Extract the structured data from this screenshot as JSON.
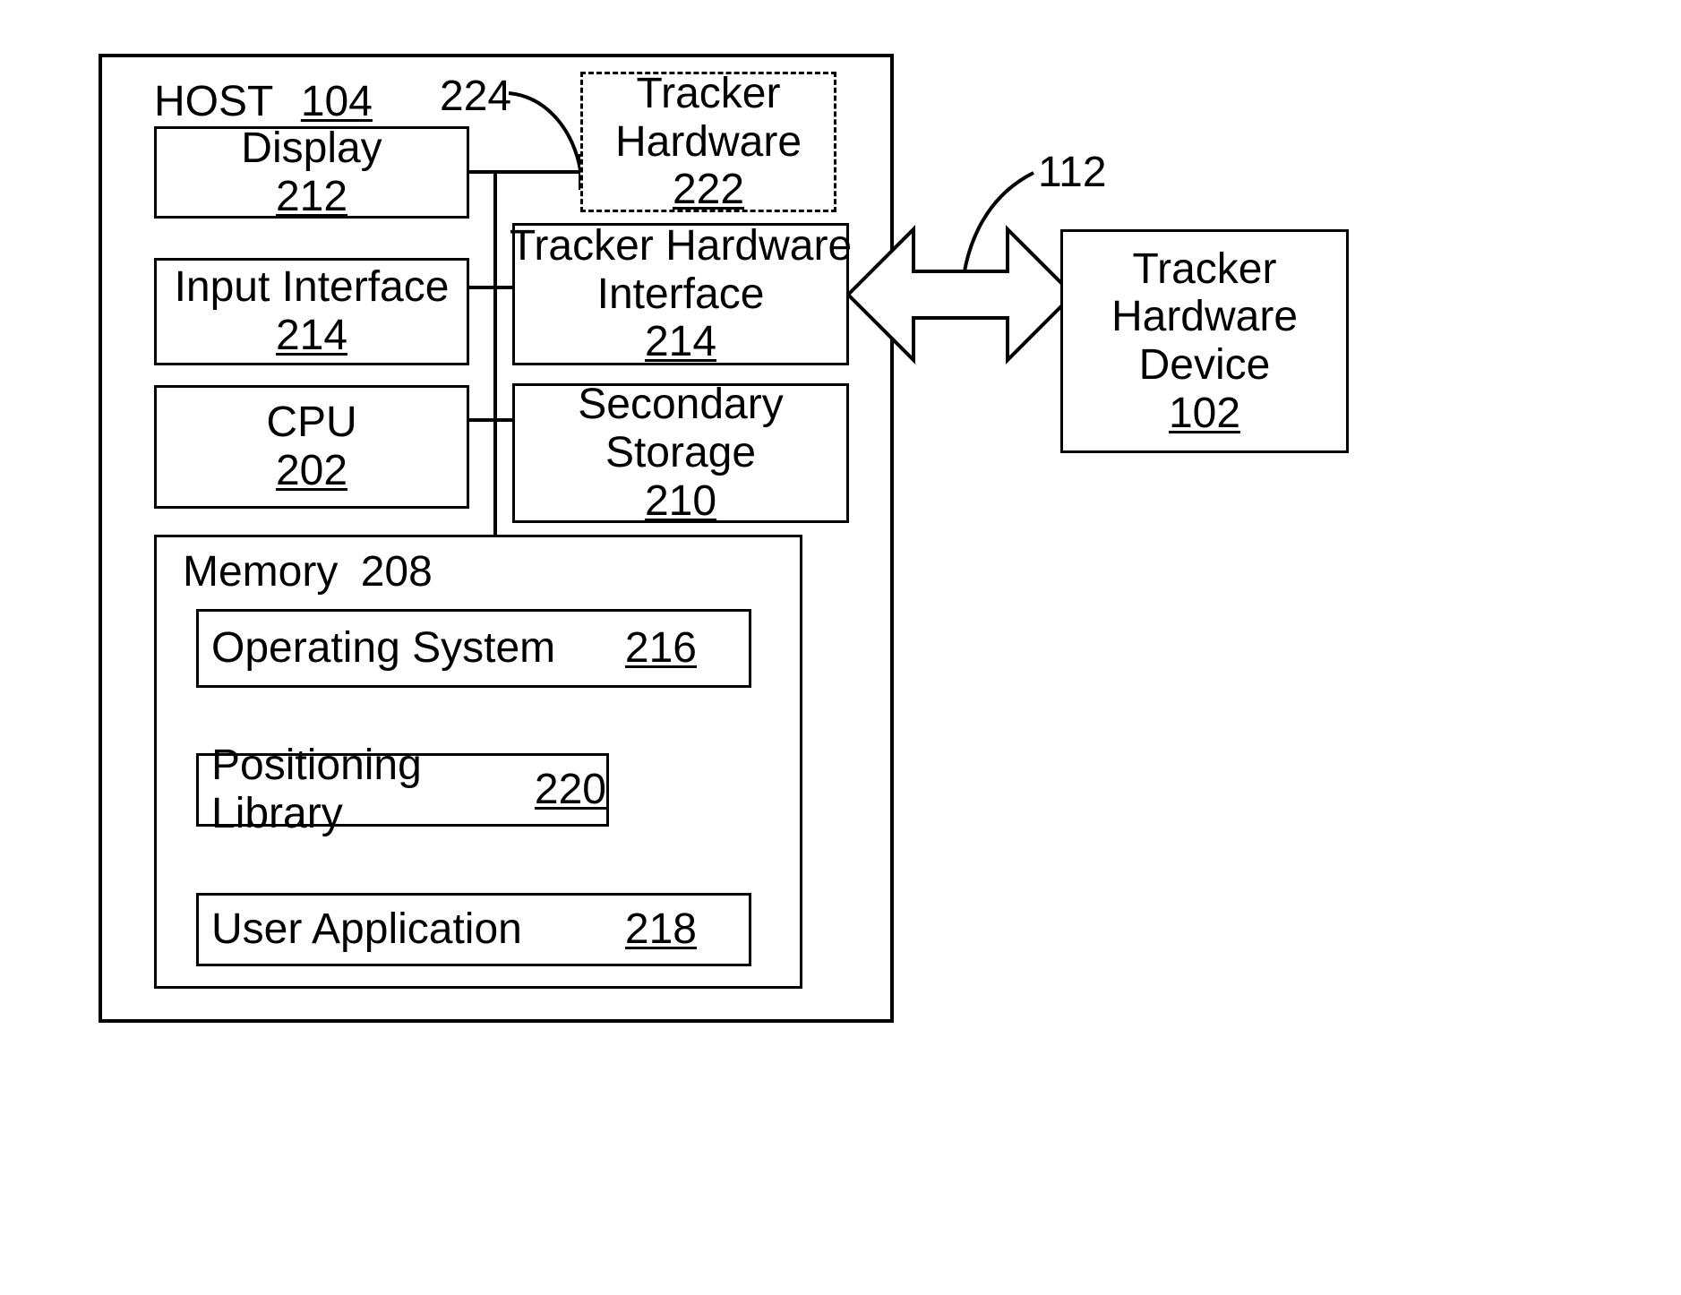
{
  "figure": {
    "type": "patent-block-diagram",
    "host": {
      "label": "HOST",
      "ref": "104"
    },
    "leaders": [
      {
        "name": "tracker-hardware-leader",
        "ref": "224"
      },
      {
        "name": "interconnect-leader",
        "ref": "112"
      }
    ],
    "blocks": [
      {
        "key": "display",
        "lines": [
          "Display"
        ],
        "ref": "212",
        "ref_underlined": true,
        "style": "solid"
      },
      {
        "key": "input_interface",
        "lines": [
          "Input Interface"
        ],
        "ref": "214",
        "ref_underlined": true,
        "style": "solid"
      },
      {
        "key": "cpu",
        "lines": [
          "CPU"
        ],
        "ref": "202",
        "ref_underlined": true,
        "style": "solid"
      },
      {
        "key": "tracker_hardware",
        "lines": [
          "Tracker",
          "Hardware"
        ],
        "ref": "222",
        "ref_underlined": true,
        "style": "dashed"
      },
      {
        "key": "tracker_hw_iface",
        "lines": [
          "Tracker Hardware",
          "Interface"
        ],
        "ref": "214",
        "ref_underlined": true,
        "style": "solid"
      },
      {
        "key": "secondary_storage",
        "lines": [
          "Secondary",
          "Storage"
        ],
        "ref": "210",
        "ref_underlined": true,
        "style": "solid"
      },
      {
        "key": "tracker_hw_device",
        "lines": [
          "Tracker",
          "Hardware",
          "Device"
        ],
        "ref": "102",
        "ref_underlined": true,
        "style": "solid"
      }
    ],
    "memory": {
      "label": "Memory",
      "ref": "208",
      "ref_underlined": false,
      "items": [
        {
          "key": "operating_system",
          "label": "Operating System",
          "ref": "216",
          "ref_underlined": true
        },
        {
          "key": "positioning_library",
          "label": "Positioning Library",
          "ref": "220",
          "ref_underlined": true
        },
        {
          "key": "user_application",
          "label": "User Application",
          "ref": "218",
          "ref_underlined": true
        }
      ]
    },
    "connectors": [
      {
        "name": "os-to-positioning-library",
        "kind": "double-headed-arrow"
      },
      {
        "name": "positioning-library-to-user-application",
        "kind": "double-headed-arrow"
      },
      {
        "name": "os-to-user-application",
        "kind": "double-headed-arrow"
      },
      {
        "name": "tracker-interface-to-device",
        "kind": "bidirectional-block-arrow"
      }
    ],
    "colors": {
      "ink": "#000000",
      "paper": "#ffffff"
    }
  }
}
